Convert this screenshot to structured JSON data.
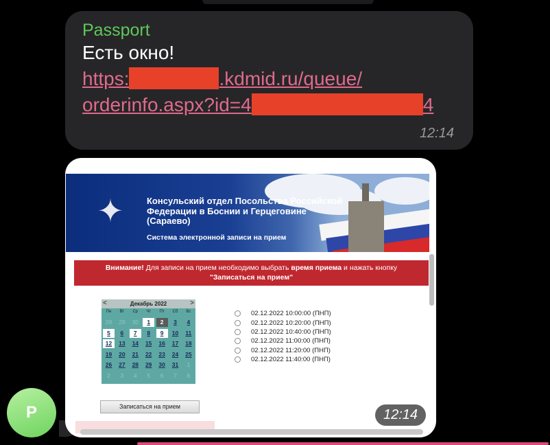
{
  "message1": {
    "sender": "Passport",
    "text": "Есть окно!",
    "link_line1_prefix": "https:",
    "link_line1_suffix": ".kdmid.ru/queue/",
    "link_line2_prefix": "orderinfo.aspx?id=4",
    "link_line2_suffix": "4",
    "time": "12:14"
  },
  "avatar": {
    "letter": "P"
  },
  "screenshot": {
    "banner_title": "Консульский отдел Посольства Российской Федерации в Боснии и Герцеговине (Сараево)",
    "banner_subtitle": "Система электронной записи на прием",
    "alert_bold1": "Внимание!",
    "alert_text1": " Для записи на прием необходимо выбрать ",
    "alert_bold2": "время приема",
    "alert_text2": " и нажать кнопку",
    "alert_bold3": "\"Записаться на прием\"",
    "calendar_month": "Декабрь 2022",
    "calendar_prev": "<",
    "calendar_next": ">",
    "weekdays": [
      "Пн",
      "Вт",
      "Ср",
      "Чт",
      "Пт",
      "Сб",
      "Вс"
    ],
    "weeks": [
      [
        "28",
        "29",
        "30",
        "1",
        "2",
        "3",
        "4"
      ],
      [
        "5",
        "6",
        "7",
        "8",
        "9",
        "10",
        "11"
      ],
      [
        "12",
        "13",
        "14",
        "15",
        "16",
        "17",
        "18"
      ],
      [
        "19",
        "20",
        "21",
        "22",
        "23",
        "24",
        "25"
      ],
      [
        "26",
        "27",
        "28",
        "29",
        "30",
        "31",
        "1"
      ],
      [
        "2",
        "3",
        "4",
        "5",
        "6",
        "7",
        "8"
      ]
    ],
    "selected_day": "2",
    "time_slots": [
      "02.12.2022 10:00:00 (ПНП)",
      "02.12.2022 10:20:00 (ПНП)",
      "02.12.2022 10:40:00 (ПНП)",
      "02.12.2022 11:00:00 (ПНП)",
      "02.12.2022 11:20:00 (ПНП)",
      "02.12.2022 11:40:00 (ПНП)"
    ],
    "submit_label": "Записаться на прием"
  },
  "message2": {
    "time": "12:14"
  },
  "colors": {
    "sender": "#5fc75b",
    "link": "#e06a8c",
    "redaction": "#e8412a",
    "alert": "#c0282f",
    "calendar": "#5ea8a4"
  }
}
